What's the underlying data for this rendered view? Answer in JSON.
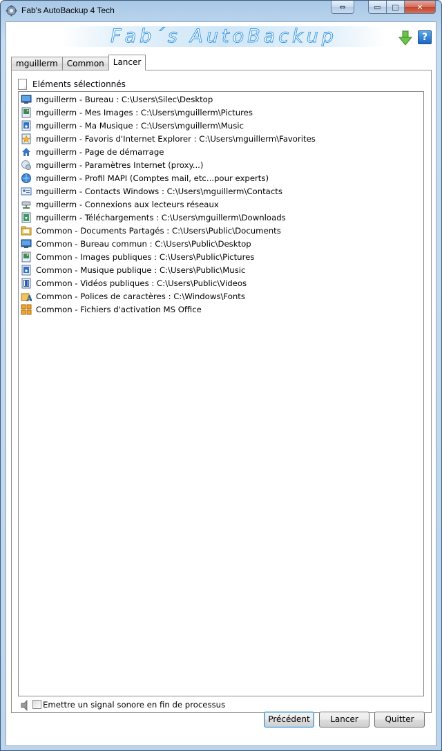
{
  "window": {
    "title": "Fab's AutoBackup 4 Tech",
    "caption_buttons": {
      "resize": "⇔",
      "minimize": "▭",
      "maximize": "□",
      "close": "✕"
    }
  },
  "header": {
    "banner_text": "Fab´s AutoBackup",
    "help_glyph": "?"
  },
  "tabs": [
    {
      "label": "mguillerm",
      "active": false
    },
    {
      "label": "Common",
      "active": false
    },
    {
      "label": "Lancer",
      "active": true
    }
  ],
  "list_header": "Eléments sélectionnés",
  "items": [
    {
      "label": "mguillerm - Bureau : C:\\Users\\Silec\\Desktop",
      "icon": "desktop-icon"
    },
    {
      "label": "mguillerm - Mes Images : C:\\Users\\mguillerm\\Pictures",
      "icon": "pictures-icon"
    },
    {
      "label": "mguillerm - Ma Musique : C:\\Users\\mguillerm\\Music",
      "icon": "music-icon"
    },
    {
      "label": "mguillerm - Favoris d'Internet Explorer : C:\\Users\\mguillerm\\Favorites",
      "icon": "favorites-icon"
    },
    {
      "label": "mguillerm - Page de démarrage",
      "icon": "homepage-icon"
    },
    {
      "label": "mguillerm - Paramètres Internet (proxy...)",
      "icon": "internet-settings-icon"
    },
    {
      "label": "mguillerm - Profil MAPI (Comptes mail, etc...pour experts)",
      "icon": "mail-profile-icon"
    },
    {
      "label": "mguillerm - Contacts Windows : C:\\Users\\mguillerm\\Contacts",
      "icon": "contacts-icon"
    },
    {
      "label": "mguillerm - Connexions aux lecteurs réseaux",
      "icon": "network-drive-icon"
    },
    {
      "label": "mguillerm - Téléchargements : C:\\Users\\mguillerm\\Downloads",
      "icon": "downloads-icon"
    },
    {
      "label": "Common - Documents Partagés : C:\\Users\\Public\\Documents",
      "icon": "shared-documents-icon"
    },
    {
      "label": "Common - Bureau commun : C:\\Users\\Public\\Desktop",
      "icon": "desktop-icon"
    },
    {
      "label": "Common - Images publiques : C:\\Users\\Public\\Pictures",
      "icon": "pictures-icon"
    },
    {
      "label": "Common - Musique publique : C:\\Users\\Public\\Music",
      "icon": "music-icon"
    },
    {
      "label": "Common - Vidéos publiques : C:\\Users\\Public\\Videos",
      "icon": "videos-icon"
    },
    {
      "label": "Common - Polices de caractères : C:\\Windows\\Fonts",
      "icon": "fonts-icon"
    },
    {
      "label": "Common - Fichiers d'activation MS Office",
      "icon": "office-icon"
    }
  ],
  "sound_option": {
    "label": "Emettre un signal sonore en fin de processus",
    "checked": false
  },
  "buttons": {
    "previous": "Précédent",
    "run": "Lancer",
    "quit": "Quitter"
  }
}
